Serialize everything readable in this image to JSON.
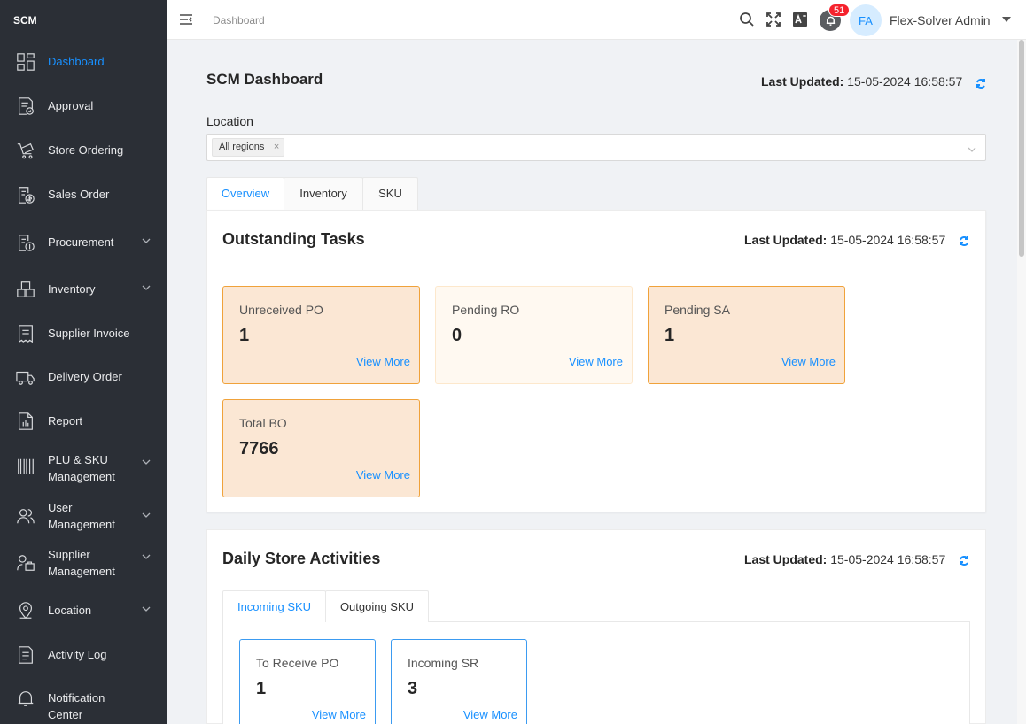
{
  "sidebar": {
    "brand": "SCM",
    "items": [
      {
        "label": "Dashboard",
        "icon": "dashboard-icon",
        "active": true
      },
      {
        "label": "Approval",
        "icon": "approval-icon"
      },
      {
        "label": "Store Ordering",
        "icon": "store-ordering-icon"
      },
      {
        "label": "Sales Order",
        "icon": "sales-order-icon"
      },
      {
        "label": "Procurement",
        "icon": "procurement-icon",
        "expandable": true
      },
      {
        "label": "Inventory",
        "icon": "inventory-icon",
        "expandable": true
      },
      {
        "label": "Supplier Invoice",
        "icon": "supplier-invoice-icon"
      },
      {
        "label": "Delivery Order",
        "icon": "delivery-truck-icon"
      },
      {
        "label": "Report",
        "icon": "report-icon"
      },
      {
        "label": "PLU & SKU Management",
        "icon": "barcode-icon",
        "expandable": true
      },
      {
        "label": "User Management",
        "icon": "users-icon",
        "expandable": true
      },
      {
        "label": "Supplier Management",
        "icon": "supplier-icon",
        "expandable": true
      },
      {
        "label": "Location",
        "icon": "location-pin-icon",
        "expandable": true
      },
      {
        "label": "Activity Log",
        "icon": "activity-log-icon"
      },
      {
        "label": "Notification Center",
        "icon": "bell-icon"
      }
    ]
  },
  "header": {
    "breadcrumb": "Dashboard",
    "notification_count": "51",
    "avatar_initials": "FA",
    "user_name": "Flex-Solver Admin"
  },
  "page": {
    "title": "SCM Dashboard",
    "last_updated_label": "Last Updated:",
    "last_updated_value": "15-05-2024 16:58:57",
    "location_label": "Location",
    "location_tag": "All regions",
    "tabs": [
      "Overview",
      "Inventory",
      "SKU"
    ]
  },
  "outstanding": {
    "title": "Outstanding Tasks",
    "last_updated_label": "Last Updated:",
    "last_updated_value": "15-05-2024 16:58:57",
    "cards": [
      {
        "title": "Unreceived PO",
        "value": "1",
        "link": "View More"
      },
      {
        "title": "Pending RO",
        "value": "0",
        "link": "View More"
      },
      {
        "title": "Pending SA",
        "value": "1",
        "link": "View More"
      },
      {
        "title": "Total BO",
        "value": "7766",
        "link": "View More"
      }
    ]
  },
  "daily": {
    "title": "Daily Store Activities",
    "last_updated_label": "Last Updated:",
    "last_updated_value": "15-05-2024 16:58:57",
    "tabs": [
      "Incoming SKU",
      "Outgoing SKU"
    ],
    "cards": [
      {
        "title": "To Receive PO",
        "value": "1",
        "link": "View More"
      },
      {
        "title": "Incoming SR",
        "value": "3",
        "link": "View More"
      }
    ]
  },
  "colors": {
    "sidebar_bg": "#2b2f36",
    "accent": "#1890ff",
    "card_orange_bg": "#fbe7d4",
    "card_orange_border": "#f0a23a",
    "badge_red": "#f5222d"
  }
}
